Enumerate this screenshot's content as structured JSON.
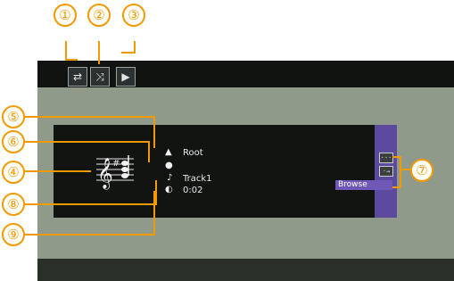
{
  "callouts": {
    "c1": "①",
    "c2": "②",
    "c3": "③",
    "c4": "④",
    "c5": "⑤",
    "c6": "⑥",
    "c7": "⑦",
    "c8": "⑧",
    "c9": "⑨"
  },
  "controls": {
    "repeat_icon": "⇄",
    "shuffle_icon": "⤨",
    "play_icon": "▶"
  },
  "info": {
    "folder_label": "Root",
    "track_label": "Track1",
    "time_label": "0:02"
  },
  "buttons": {
    "browse_label": "Browse"
  },
  "icons": {
    "folder_icon": "folder-icon",
    "disc_icon": "disc-icon",
    "note_icon": "music-note-icon",
    "clock_icon": "clock-icon",
    "music_art": "music-staff-icon"
  },
  "colors": {
    "callout": "#f39a00",
    "screen_bg": "#8f9a8a",
    "panel_bg": "#121412",
    "scroll_bg": "#5c4a9e",
    "browse_bg": "#6f58b8"
  }
}
